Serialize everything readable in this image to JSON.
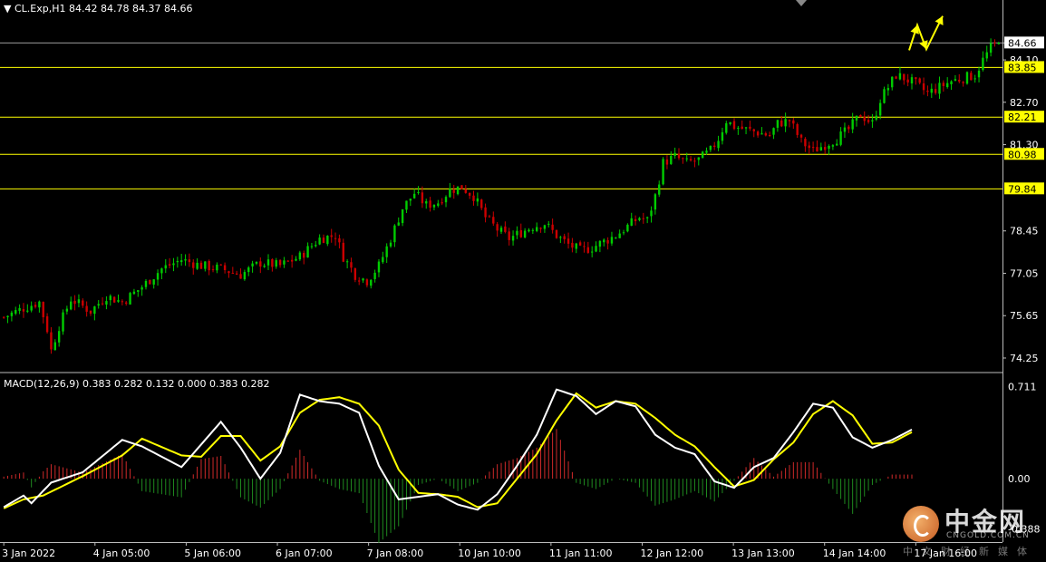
{
  "header": {
    "symbol": "CL.Exp,H1",
    "ohlc": "84.42 84.78 84.37 84.66",
    "macd_label": "MACD(12,26,9) 0.383 0.282 0.132 0.000 0.383 0.282"
  },
  "logo": {
    "cn": "中金网",
    "en": "CNGOLD.COM.CN",
    "sub": "中文财经新媒体"
  },
  "colors": {
    "background": "#000000",
    "bull": "#00cc00",
    "bear": "#cc0000",
    "level_line": "#ffff00",
    "arrow": "#ffff00",
    "macd_line": "#ffffff",
    "signal_line": "#ffff00"
  },
  "chart_data": [
    {
      "type": "candlestick",
      "y_ticks": [
        "84.66",
        "84.10",
        "82.70",
        "81.30",
        "78.45",
        "77.05",
        "75.65",
        "74.25"
      ],
      "horizontal_levels": [
        "83.85",
        "82.21",
        "80.98",
        "79.84"
      ],
      "current_price": "84.66",
      "ylim": [
        73.8,
        85.6
      ],
      "x_tick_labels": [
        "3 Jan 2022",
        "4 Jan 05:00",
        "5 Jan 06:00",
        "6 Jan 07:00",
        "7 Jan 08:00",
        "10 Jan 10:00",
        "11 Jan 11:00",
        "12 Jan 12:00",
        "13 Jan 13:00",
        "14 Jan 14:00",
        "17 Jan 16:00"
      ],
      "close_path": [
        [
          0,
          75.6
        ],
        [
          5,
          75.9
        ],
        [
          9,
          76.1
        ],
        [
          11,
          75.2
        ],
        [
          12,
          74.5
        ],
        [
          14,
          75.3
        ],
        [
          17,
          76.2
        ],
        [
          22,
          75.8
        ],
        [
          26,
          76.3
        ],
        [
          30,
          76.1
        ],
        [
          35,
          76.6
        ],
        [
          40,
          77.2
        ],
        [
          45,
          77.5
        ],
        [
          50,
          77.3
        ],
        [
          55,
          77.2
        ],
        [
          60,
          77.0
        ],
        [
          65,
          77.4
        ],
        [
          70,
          77.3
        ],
        [
          75,
          77.6
        ],
        [
          80,
          78.2
        ],
        [
          84,
          78.3
        ],
        [
          86,
          77.6
        ],
        [
          89,
          77.0
        ],
        [
          92,
          76.8
        ],
        [
          95,
          77.3
        ],
        [
          98,
          78.2
        ],
        [
          101,
          79.2
        ],
        [
          104,
          79.7
        ],
        [
          107,
          79.3
        ],
        [
          110,
          79.4
        ],
        [
          113,
          79.8
        ],
        [
          116,
          79.9
        ],
        [
          119,
          79.6
        ],
        [
          122,
          78.9
        ],
        [
          125,
          78.5
        ],
        [
          128,
          78.2
        ],
        [
          131,
          78.4
        ],
        [
          134,
          78.6
        ],
        [
          137,
          78.7
        ],
        [
          140,
          78.3
        ],
        [
          143,
          78.0
        ],
        [
          146,
          77.8
        ],
        [
          149,
          77.9
        ],
        [
          152,
          78.1
        ],
        [
          155,
          78.3
        ],
        [
          158,
          78.6
        ],
        [
          161,
          78.9
        ],
        [
          163,
          78.8
        ],
        [
          165,
          79.6
        ],
        [
          167,
          80.7
        ],
        [
          170,
          80.9
        ],
        [
          173,
          80.7
        ],
        [
          176,
          80.8
        ],
        [
          179,
          81.1
        ],
        [
          181,
          81.5
        ],
        [
          183,
          82.1
        ],
        [
          185,
          81.9
        ],
        [
          188,
          81.8
        ],
        [
          191,
          81.7
        ],
        [
          194,
          81.6
        ],
        [
          196,
          82.0
        ],
        [
          199,
          82.1
        ],
        [
          202,
          81.4
        ],
        [
          205,
          81.1
        ],
        [
          208,
          81.3
        ],
        [
          211,
          81.5
        ],
        [
          214,
          81.8
        ],
        [
          217,
          82.3
        ],
        [
          220,
          82.0
        ],
        [
          222,
          82.8
        ],
        [
          224,
          83.2
        ],
        [
          226,
          83.6
        ],
        [
          228,
          83.5
        ],
        [
          231,
          83.3
        ],
        [
          234,
          83.0
        ],
        [
          237,
          83.2
        ],
        [
          240,
          83.4
        ],
        [
          243,
          83.5
        ],
        [
          246,
          83.6
        ],
        [
          248,
          84.1
        ],
        [
          250,
          84.5
        ],
        [
          252,
          84.66
        ]
      ]
    },
    {
      "type": "macd",
      "params": "12,26,9",
      "y_ticks": [
        "0.711",
        "0.00",
        "-0.388"
      ],
      "ylim": [
        -0.49,
        0.8
      ],
      "macd": [
        [
          0,
          -0.22
        ],
        [
          5,
          -0.13
        ],
        [
          7,
          -0.19
        ],
        [
          12,
          -0.03
        ],
        [
          20,
          0.05
        ],
        [
          30,
          0.3
        ],
        [
          35,
          0.25
        ],
        [
          45,
          0.09
        ],
        [
          55,
          0.44
        ],
        [
          60,
          0.24
        ],
        [
          65,
          0.0
        ],
        [
          70,
          0.2
        ],
        [
          75,
          0.65
        ],
        [
          80,
          0.6
        ],
        [
          85,
          0.58
        ],
        [
          90,
          0.51
        ],
        [
          95,
          0.1
        ],
        [
          100,
          -0.16
        ],
        [
          110,
          -0.12
        ],
        [
          115,
          -0.2
        ],
        [
          120,
          -0.24
        ],
        [
          125,
          -0.12
        ],
        [
          130,
          0.1
        ],
        [
          135,
          0.34
        ],
        [
          140,
          0.69
        ],
        [
          145,
          0.64
        ],
        [
          150,
          0.5
        ],
        [
          155,
          0.6
        ],
        [
          160,
          0.56
        ],
        [
          165,
          0.34
        ],
        [
          170,
          0.24
        ],
        [
          175,
          0.19
        ],
        [
          180,
          -0.02
        ],
        [
          185,
          -0.07
        ],
        [
          190,
          0.09
        ],
        [
          195,
          0.16
        ],
        [
          200,
          0.36
        ],
        [
          205,
          0.58
        ],
        [
          210,
          0.55
        ],
        [
          215,
          0.32
        ],
        [
          220,
          0.24
        ],
        [
          225,
          0.3
        ],
        [
          230,
          0.38
        ]
      ],
      "signal": [
        [
          0,
          -0.23
        ],
        [
          5,
          -0.16
        ],
        [
          10,
          -0.13
        ],
        [
          20,
          0.02
        ],
        [
          30,
          0.18
        ],
        [
          35,
          0.31
        ],
        [
          45,
          0.18
        ],
        [
          50,
          0.17
        ],
        [
          55,
          0.33
        ],
        [
          60,
          0.33
        ],
        [
          65,
          0.14
        ],
        [
          70,
          0.25
        ],
        [
          75,
          0.51
        ],
        [
          80,
          0.61
        ],
        [
          85,
          0.63
        ],
        [
          90,
          0.58
        ],
        [
          95,
          0.41
        ],
        [
          100,
          0.07
        ],
        [
          105,
          -0.11
        ],
        [
          110,
          -0.12
        ],
        [
          115,
          -0.14
        ],
        [
          120,
          -0.22
        ],
        [
          125,
          -0.19
        ],
        [
          130,
          0.0
        ],
        [
          135,
          0.19
        ],
        [
          140,
          0.45
        ],
        [
          145,
          0.66
        ],
        [
          150,
          0.55
        ],
        [
          155,
          0.6
        ],
        [
          160,
          0.58
        ],
        [
          165,
          0.47
        ],
        [
          170,
          0.34
        ],
        [
          175,
          0.25
        ],
        [
          180,
          0.09
        ],
        [
          185,
          -0.06
        ],
        [
          190,
          -0.01
        ],
        [
          195,
          0.15
        ],
        [
          200,
          0.28
        ],
        [
          205,
          0.5
        ],
        [
          210,
          0.6
        ],
        [
          215,
          0.49
        ],
        [
          220,
          0.27
        ],
        [
          225,
          0.28
        ],
        [
          230,
          0.36
        ]
      ]
    }
  ]
}
